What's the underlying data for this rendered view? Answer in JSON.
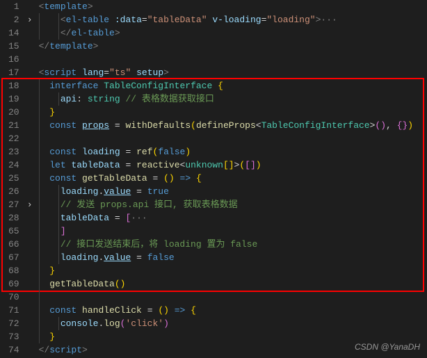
{
  "watermark": "CSDN @YanaDH",
  "gutter_lines": [
    "1",
    "2",
    "14",
    "15",
    "16",
    "17",
    "18",
    "19",
    "20",
    "21",
    "22",
    "23",
    "24",
    "25",
    "26",
    "27",
    "28",
    "65",
    "66",
    "67",
    "68",
    "69",
    "70",
    "71",
    "72",
    "73",
    "74"
  ],
  "fold_markers": {
    "1": ">",
    "15": ">"
  },
  "highlight_box": {
    "top_line_index": 6,
    "bottom_line_index": 21
  },
  "code": {
    "l0": {
      "tokens": [
        {
          "c": "t-punct",
          "t": "<"
        },
        {
          "c": "t-tag",
          "t": "template"
        },
        {
          "c": "t-punct",
          "t": ">"
        }
      ]
    },
    "l1": {
      "indent": 1,
      "tokens": [
        {
          "c": "t-punct",
          "t": "<"
        },
        {
          "c": "t-tag",
          "t": "el-table"
        },
        {
          "c": "",
          "t": " "
        },
        {
          "c": "t-attr",
          "t": ":data"
        },
        {
          "c": "t-op",
          "t": "="
        },
        {
          "c": "t-str",
          "t": "\"tableData\""
        },
        {
          "c": "",
          "t": " "
        },
        {
          "c": "t-attr",
          "t": "v-loading"
        },
        {
          "c": "t-op",
          "t": "="
        },
        {
          "c": "t-str",
          "t": "\"loading\""
        },
        {
          "c": "t-punct",
          "t": ">"
        },
        {
          "c": "t-dim",
          "t": "···"
        }
      ]
    },
    "l2": {
      "indent": 1,
      "tokens": [
        {
          "c": "t-punct",
          "t": "</"
        },
        {
          "c": "t-tag",
          "t": "el-table"
        },
        {
          "c": "t-punct",
          "t": ">"
        }
      ]
    },
    "l3": {
      "tokens": [
        {
          "c": "t-punct",
          "t": "</"
        },
        {
          "c": "t-tag",
          "t": "template"
        },
        {
          "c": "t-punct",
          "t": ">"
        }
      ]
    },
    "l4": {
      "tokens": []
    },
    "l5": {
      "tokens": [
        {
          "c": "t-punct",
          "t": "<"
        },
        {
          "c": "t-tag",
          "t": "script"
        },
        {
          "c": "",
          "t": " "
        },
        {
          "c": "t-attr",
          "t": "lang"
        },
        {
          "c": "t-op",
          "t": "="
        },
        {
          "c": "t-str",
          "t": "\"ts\""
        },
        {
          "c": "",
          "t": " "
        },
        {
          "c": "t-attr",
          "t": "setup"
        },
        {
          "c": "t-punct",
          "t": ">"
        }
      ]
    },
    "l6": {
      "indent": 0,
      "tokens": [
        {
          "c": "t-kw",
          "t": "interface"
        },
        {
          "c": "",
          "t": " "
        },
        {
          "c": "t-type",
          "t": "TableConfigInterface"
        },
        {
          "c": "",
          "t": " "
        },
        {
          "c": "t-brace",
          "t": "{"
        }
      ]
    },
    "l7": {
      "indent": 1,
      "tokens": [
        {
          "c": "t-var",
          "t": "api"
        },
        {
          "c": "t-op",
          "t": ":"
        },
        {
          "c": "",
          "t": " "
        },
        {
          "c": "t-type",
          "t": "string"
        },
        {
          "c": "",
          "t": " "
        },
        {
          "c": "t-comment",
          "t": "// 表格数据获取接口"
        }
      ]
    },
    "l8": {
      "indent": 0,
      "tokens": [
        {
          "c": "t-brace",
          "t": "}"
        }
      ]
    },
    "l9": {
      "indent": 0,
      "tokens": [
        {
          "c": "t-kw",
          "t": "const"
        },
        {
          "c": "",
          "t": " "
        },
        {
          "c": "t-var t-underline",
          "t": "props"
        },
        {
          "c": "",
          "t": " "
        },
        {
          "c": "t-op",
          "t": "="
        },
        {
          "c": "",
          "t": " "
        },
        {
          "c": "t-func",
          "t": "withDefaults"
        },
        {
          "c": "t-brace",
          "t": "("
        },
        {
          "c": "t-func",
          "t": "defineProps"
        },
        {
          "c": "t-op",
          "t": "<"
        },
        {
          "c": "t-type",
          "t": "TableConfigInterface"
        },
        {
          "c": "t-op",
          "t": ">"
        },
        {
          "c": "t-brace2",
          "t": "()"
        },
        {
          "c": "t-op",
          "t": ", "
        },
        {
          "c": "t-brace2",
          "t": "{}"
        },
        {
          "c": "t-brace",
          "t": ")"
        }
      ]
    },
    "l10": {
      "tokens": []
    },
    "l11": {
      "indent": 0,
      "tokens": [
        {
          "c": "t-kw",
          "t": "const"
        },
        {
          "c": "",
          "t": " "
        },
        {
          "c": "t-var",
          "t": "loading"
        },
        {
          "c": "",
          "t": " "
        },
        {
          "c": "t-op",
          "t": "="
        },
        {
          "c": "",
          "t": " "
        },
        {
          "c": "t-func",
          "t": "ref"
        },
        {
          "c": "t-brace",
          "t": "("
        },
        {
          "c": "t-bool",
          "t": "false"
        },
        {
          "c": "t-brace",
          "t": ")"
        }
      ]
    },
    "l12": {
      "indent": 0,
      "tokens": [
        {
          "c": "t-kw",
          "t": "let"
        },
        {
          "c": "",
          "t": " "
        },
        {
          "c": "t-var",
          "t": "tableData"
        },
        {
          "c": "",
          "t": " "
        },
        {
          "c": "t-op",
          "t": "="
        },
        {
          "c": "",
          "t": " "
        },
        {
          "c": "t-func",
          "t": "reactive"
        },
        {
          "c": "t-op",
          "t": "<"
        },
        {
          "c": "t-type",
          "t": "unknown"
        },
        {
          "c": "t-brace",
          "t": "[]"
        },
        {
          "c": "t-op",
          "t": ">"
        },
        {
          "c": "t-brace",
          "t": "("
        },
        {
          "c": "t-brace2",
          "t": "[]"
        },
        {
          "c": "t-brace",
          "t": ")"
        }
      ]
    },
    "l13": {
      "indent": 0,
      "tokens": [
        {
          "c": "t-kw",
          "t": "const"
        },
        {
          "c": "",
          "t": " "
        },
        {
          "c": "t-func",
          "t": "getTableData"
        },
        {
          "c": "",
          "t": " "
        },
        {
          "c": "t-op",
          "t": "="
        },
        {
          "c": "",
          "t": " "
        },
        {
          "c": "t-brace",
          "t": "()"
        },
        {
          "c": "",
          "t": " "
        },
        {
          "c": "t-kw",
          "t": "=>"
        },
        {
          "c": "",
          "t": " "
        },
        {
          "c": "t-brace",
          "t": "{"
        }
      ]
    },
    "l14": {
      "indent": 1,
      "tokens": [
        {
          "c": "t-var",
          "t": "loading"
        },
        {
          "c": "t-op",
          "t": "."
        },
        {
          "c": "t-var t-underline",
          "t": "value"
        },
        {
          "c": "",
          "t": " "
        },
        {
          "c": "t-op",
          "t": "="
        },
        {
          "c": "",
          "t": " "
        },
        {
          "c": "t-bool",
          "t": "true"
        }
      ]
    },
    "l15_comment": "// 发送 props.api 接口, 获取表格数据",
    "l15": {
      "indent": 1,
      "tokens": [
        {
          "c": "t-comment",
          "t": "// 发送 props.api 接口, 获取表格数据"
        }
      ]
    },
    "l16": {
      "indent": 1,
      "tokens": [
        {
          "c": "t-var",
          "t": "tableData"
        },
        {
          "c": "",
          "t": " "
        },
        {
          "c": "t-op",
          "t": "="
        },
        {
          "c": "",
          "t": " "
        },
        {
          "c": "t-brace2",
          "t": "["
        },
        {
          "c": "t-dim",
          "t": "···"
        }
      ]
    },
    "l17": {
      "indent": 1,
      "tokens": [
        {
          "c": "t-brace2",
          "t": "]"
        }
      ]
    },
    "l18_comment": "// 接口发送结束后，将 loading 置为 false",
    "l18": {
      "indent": 1,
      "tokens": [
        {
          "c": "t-comment",
          "t": "// 接口发送结束后，将 loading 置为 false"
        }
      ]
    },
    "l19": {
      "indent": 1,
      "tokens": [
        {
          "c": "t-var",
          "t": "loading"
        },
        {
          "c": "t-op",
          "t": "."
        },
        {
          "c": "t-var t-underline",
          "t": "value"
        },
        {
          "c": "",
          "t": " "
        },
        {
          "c": "t-op",
          "t": "="
        },
        {
          "c": "",
          "t": " "
        },
        {
          "c": "t-bool",
          "t": "false"
        }
      ]
    },
    "l20": {
      "indent": 0,
      "tokens": [
        {
          "c": "t-brace",
          "t": "}"
        }
      ]
    },
    "l21": {
      "indent": 0,
      "tokens": [
        {
          "c": "t-func",
          "t": "getTableData"
        },
        {
          "c": "t-brace",
          "t": "()"
        }
      ]
    },
    "l22": {
      "tokens": []
    },
    "l23": {
      "indent": 0,
      "tokens": [
        {
          "c": "t-kw",
          "t": "const"
        },
        {
          "c": "",
          "t": " "
        },
        {
          "c": "t-func",
          "t": "handleClick"
        },
        {
          "c": "",
          "t": " "
        },
        {
          "c": "t-op",
          "t": "="
        },
        {
          "c": "",
          "t": " "
        },
        {
          "c": "t-brace",
          "t": "()"
        },
        {
          "c": "",
          "t": " "
        },
        {
          "c": "t-kw",
          "t": "=>"
        },
        {
          "c": "",
          "t": " "
        },
        {
          "c": "t-brace",
          "t": "{"
        }
      ]
    },
    "l24": {
      "indent": 1,
      "tokens": [
        {
          "c": "t-var",
          "t": "console"
        },
        {
          "c": "t-op",
          "t": "."
        },
        {
          "c": "t-func",
          "t": "log"
        },
        {
          "c": "t-brace2",
          "t": "("
        },
        {
          "c": "t-str",
          "t": "'click'"
        },
        {
          "c": "t-brace2",
          "t": ")"
        }
      ]
    },
    "l25": {
      "indent": 0,
      "tokens": [
        {
          "c": "t-brace",
          "t": "}"
        }
      ]
    },
    "l26": {
      "tokens": [
        {
          "c": "t-punct",
          "t": "</"
        },
        {
          "c": "t-tag",
          "t": "script"
        },
        {
          "c": "t-punct",
          "t": ">"
        }
      ]
    }
  }
}
